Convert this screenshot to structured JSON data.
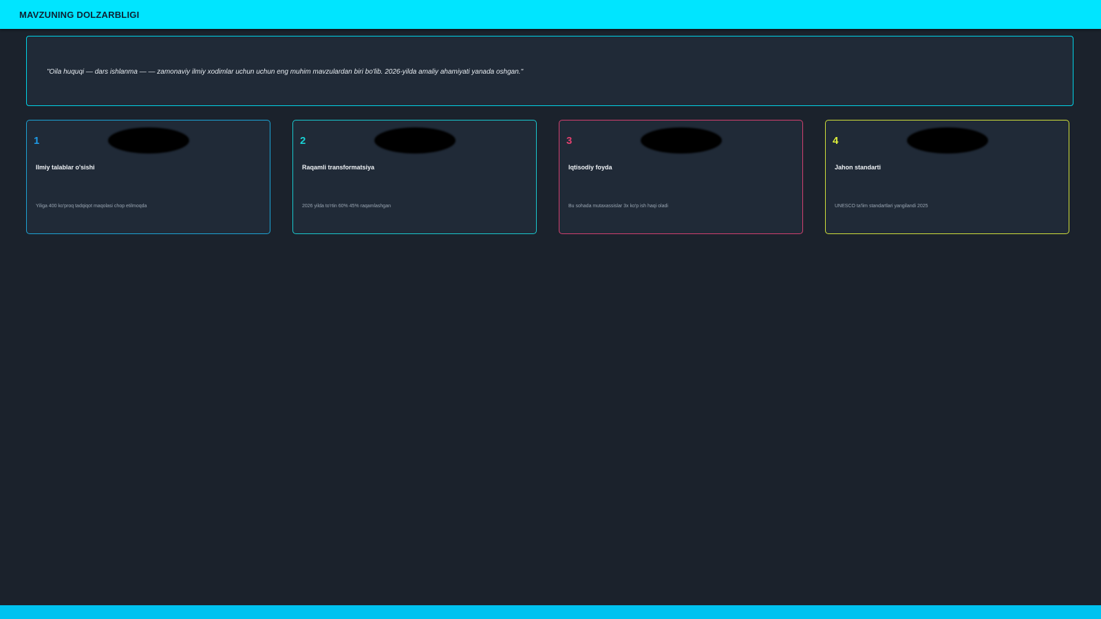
{
  "header": {
    "title": "MAVZUNING DOLZARBLIGI"
  },
  "quote": {
    "text": "\"Oila huquqi — dars ishlanma — — zamonaviy ilmiy xodimlar uchun uchun eng muhim mavzulardan biri bo'lib. 2026-yilda amaliy ahamiyati yanada oshgan.\""
  },
  "cards": [
    {
      "number": "1",
      "title": "Ilmiy talablar o'sishi",
      "description": "Yiliga 400 ko'proq tadqiqot maqolasi chop etilmoqda",
      "accent": "#1e9be8",
      "border": "#1ca6d8"
    },
    {
      "number": "2",
      "title": "Raqamli transformatsiya",
      "description": "2026 yilda to'rtin 60% 45% raqamlashgan",
      "accent": "#19d3d6",
      "border": "#19cbd2"
    },
    {
      "number": "3",
      "title": "Iqtisodiy foyda",
      "description": "Bu sohada mutaxassislar 3x ko'p ish haqi oladi",
      "accent": "#e2406f",
      "border": "#d64070"
    },
    {
      "number": "4",
      "title": "Jahon standarti",
      "description": "UNESCO ta'lim standartlari yangilandi 2025",
      "accent": "#dff03a",
      "border": "#d4e33a"
    }
  ],
  "colors": {
    "topbar": "#00e5ff",
    "background": "#1b222c",
    "panel": "#202a37",
    "bottombar": "#00c2f0"
  }
}
